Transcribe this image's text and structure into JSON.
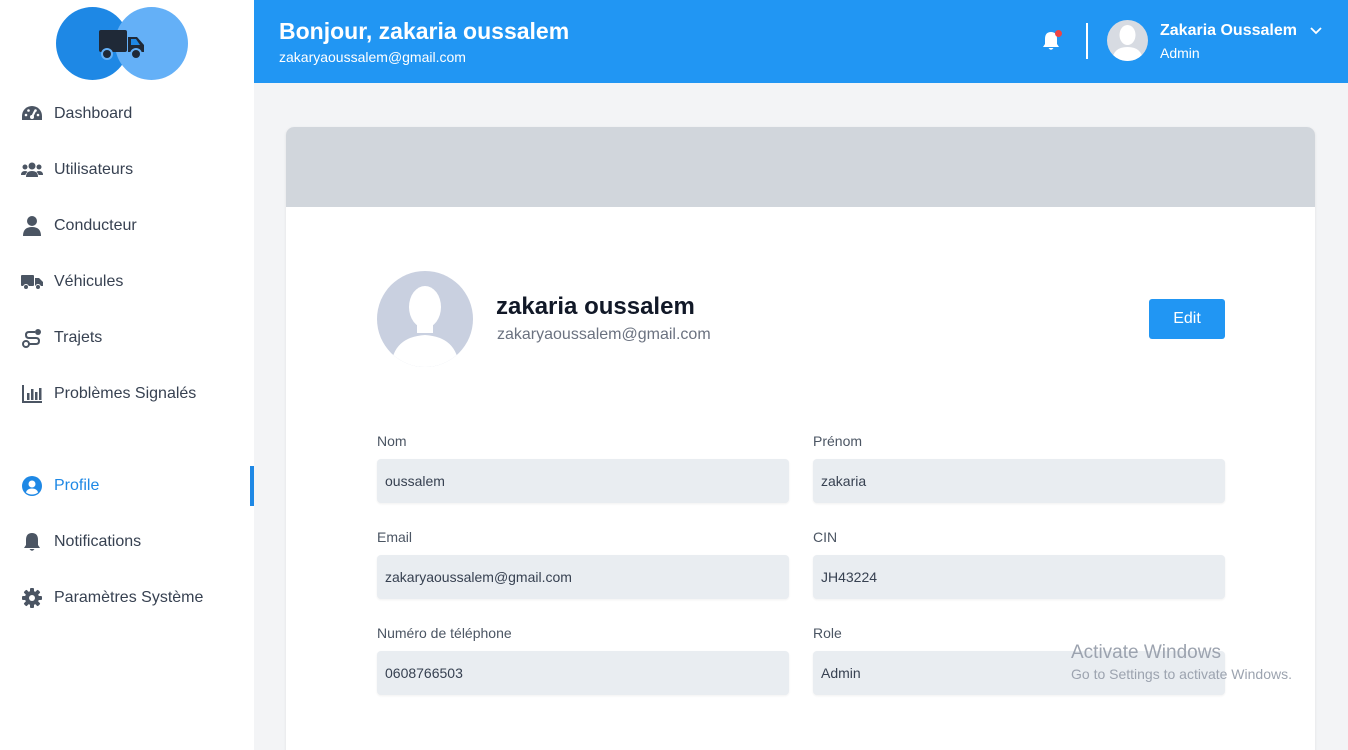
{
  "header": {
    "greeting": "Bonjour, zakaria oussalem",
    "email": "zakaryaoussalem@gmail.com",
    "user_name": "Zakaria Oussalem",
    "user_role": "Admin",
    "has_notification_dot": true
  },
  "sidebar": {
    "items": [
      {
        "label": "Dashboard",
        "icon": "gauge-icon"
      },
      {
        "label": "Utilisateurs",
        "icon": "users-icon"
      },
      {
        "label": "Conducteur",
        "icon": "user-icon"
      },
      {
        "label": "Véhicules",
        "icon": "truck-icon"
      },
      {
        "label": "Trajets",
        "icon": "route-icon"
      },
      {
        "label": "Problèmes Signalés",
        "icon": "bar-chart-icon"
      },
      {
        "label": "Profile",
        "icon": "user-circle-icon",
        "active": true
      },
      {
        "label": "Notifications",
        "icon": "bell-icon"
      },
      {
        "label": "Paramètres Système",
        "icon": "gear-icon"
      }
    ]
  },
  "profile": {
    "name": "zakaria oussalem",
    "email": "zakaryaoussalem@gmail.com",
    "edit_label": "Edit",
    "fields": {
      "nom": {
        "label": "Nom",
        "value": "oussalem"
      },
      "prenom": {
        "label": "Prénom",
        "value": "zakaria"
      },
      "email": {
        "label": "Email",
        "value": "zakaryaoussalem@gmail.com"
      },
      "cin": {
        "label": "CIN",
        "value": "JH43224"
      },
      "phone": {
        "label": "Numéro de téléphone",
        "value": "0608766503"
      },
      "role": {
        "label": "Role",
        "value": "Admin"
      }
    }
  },
  "watermark": {
    "line1": "Activate Windows",
    "line2": "Go to Settings to activate Windows."
  },
  "colors": {
    "accent": "#2196f3",
    "sidebar_text": "#374151",
    "cover": "#d1d6dc",
    "input_bg": "#e9edf1"
  }
}
